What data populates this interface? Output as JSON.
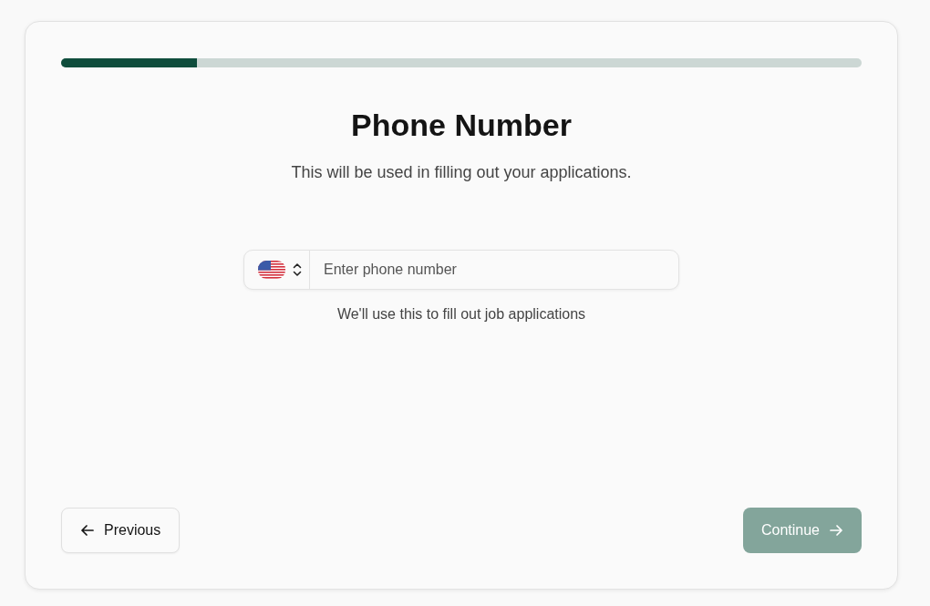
{
  "progress": {
    "level": 0.17
  },
  "title": "Phone Number",
  "subtitle": "This will be used in filling out your applications.",
  "phone_field": {
    "placeholder": "Enter phone number"
  },
  "hint": "We'll use this to fill out job applications",
  "buttons": [
    {
      "label": "Previous",
      "kind": "back",
      "disabled": false
    },
    {
      "label": "Continue",
      "kind": "next",
      "disabled": true
    }
  ]
}
